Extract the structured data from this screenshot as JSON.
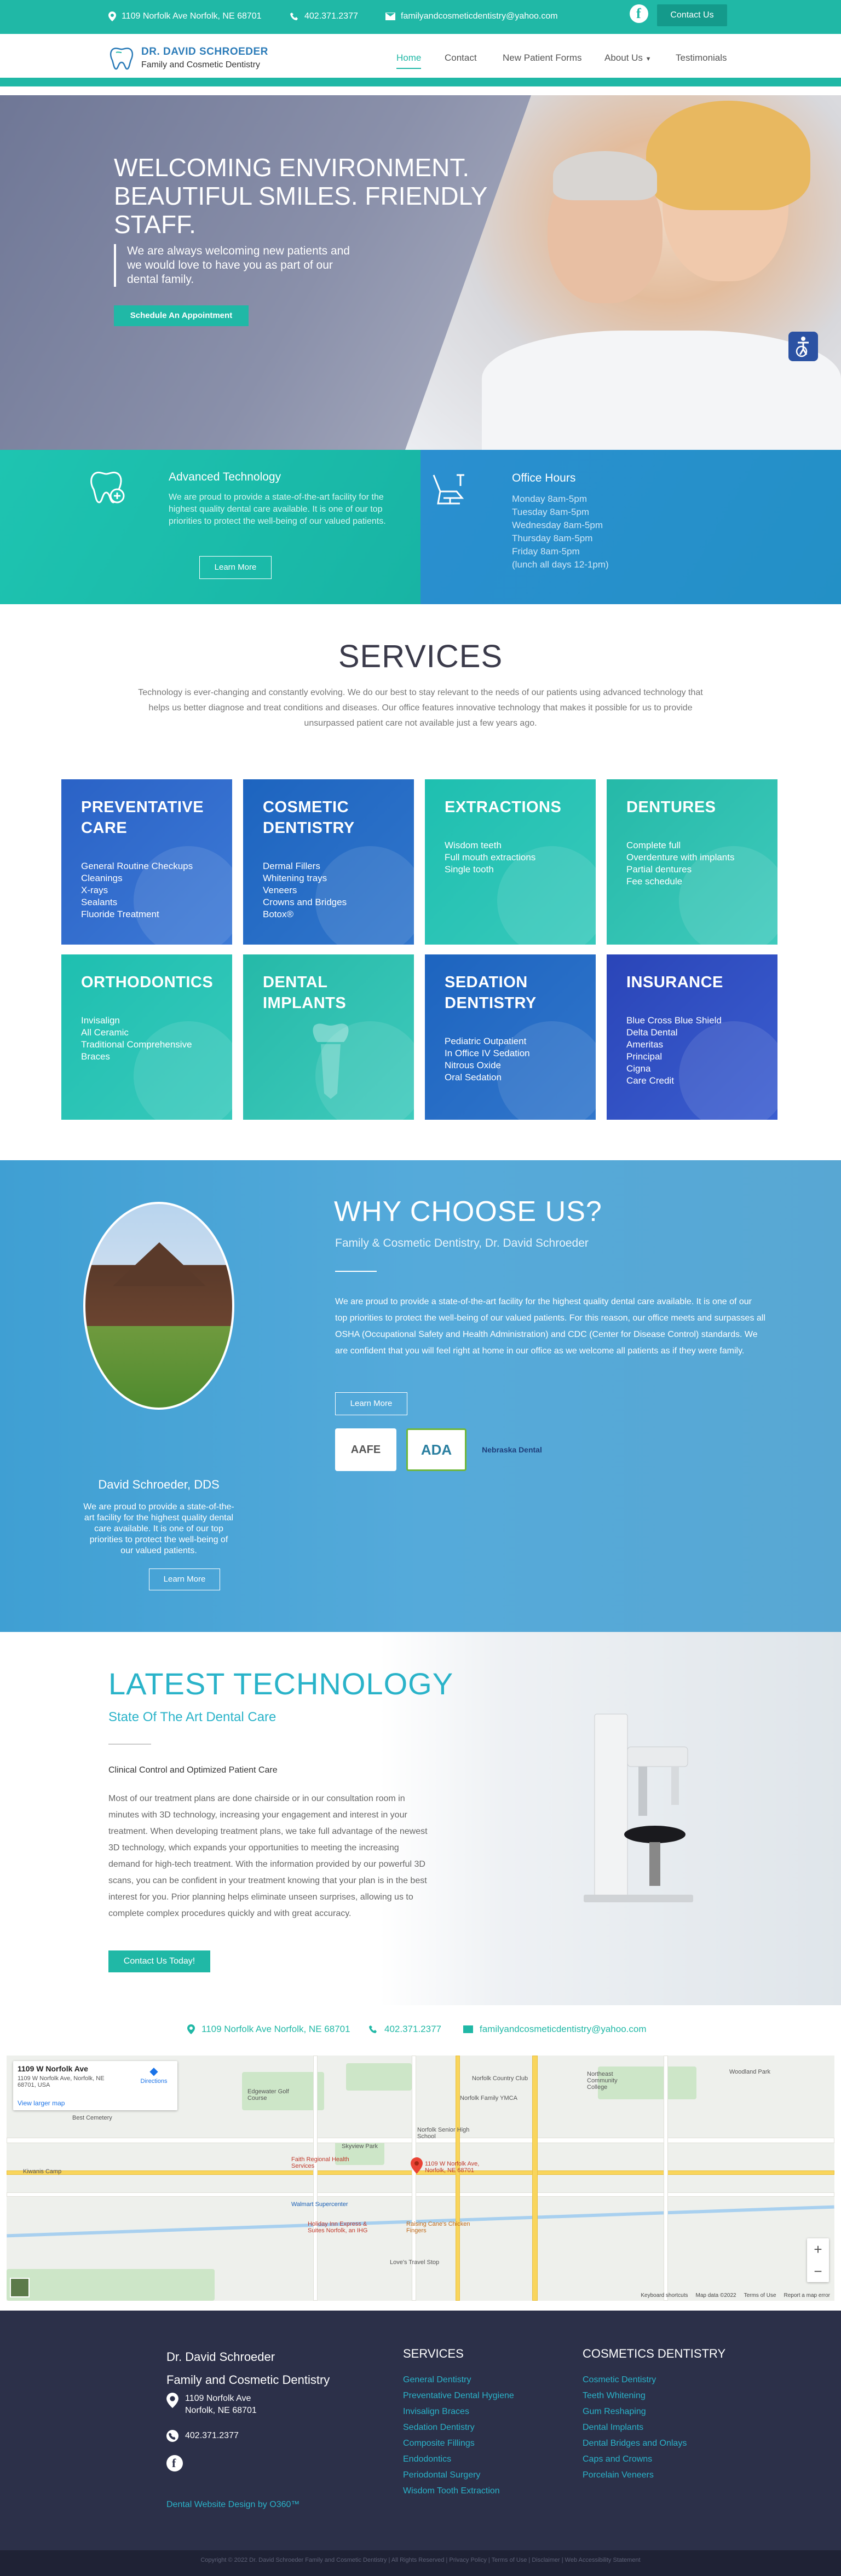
{
  "topbar": {
    "address": "1109 Norfolk Ave Norfolk, NE 68701",
    "phone": "402.371.2377",
    "email": "familyandcosmeticdentistry@yahoo.com",
    "contact_label": "Contact Us",
    "bg_color": "#20b8a6"
  },
  "logo": {
    "title": "DR. DAVID SCHROEDER",
    "subtitle": "Family and Cosmetic Dentistry"
  },
  "nav": {
    "items": [
      {
        "label": "Home"
      },
      {
        "label": "Contact"
      },
      {
        "label": "New Patient Forms"
      },
      {
        "label": "About Us"
      },
      {
        "label": "Testimonials"
      }
    ],
    "active": "Home"
  },
  "hero": {
    "headline": "WELCOMING ENVIRONMENT. BEAUTIFUL SMILES. FRIENDLY STAFF.",
    "tagline": "We are always welcoming new patients and we would love to have you as part of our dental family.",
    "button": "Schedule An Appointment"
  },
  "info": {
    "tech_title": "Advanced Technology",
    "tech_text": "We are proud to provide a state-of-the-art facility for the highest quality dental care available. It is one of our top priorities to protect the well-being of our valued patients.",
    "tech_button": "Learn More",
    "hours_title": "Office Hours",
    "hours": [
      "Monday 8am-5pm",
      "Tuesday 8am-5pm",
      "Wednesday 8am-5pm",
      "Thursday 8am-5pm",
      "Friday 8am-5pm",
      "(lunch all days 12-1pm)"
    ]
  },
  "services": {
    "title": "SERVICES",
    "text": "Technology is ever-changing and constantly evolving. We do our best to stay relevant to the needs of our patients using advanced technology that helps us better diagnose and treat conditions and diseases. Our office features innovative technology that makes it possible for us to provide unsurpassed patient care not available just a few years ago.",
    "cards": [
      {
        "title": "PREVENTATIVE CARE",
        "items": [
          "General Routine Checkups",
          "Cleanings",
          "X-rays",
          "Sealants",
          "Fluoride Treatment"
        ]
      },
      {
        "title": "COSMETIC DENTISTRY",
        "items": [
          "Dermal Fillers",
          "Whitening trays",
          "Veneers",
          "Crowns and Bridges",
          "Botox®"
        ]
      },
      {
        "title": "EXTRACTIONS",
        "items": [
          "Wisdom teeth",
          "Full mouth extractions",
          "Single tooth"
        ]
      },
      {
        "title": "DENTURES",
        "items": [
          "Complete full",
          "Overdenture with implants",
          "Partial dentures",
          "Fee schedule"
        ]
      },
      {
        "title": "ORTHODONTICS",
        "items": [
          "Invisalign",
          "All Ceramic",
          "Traditional Comprehensive",
          "Braces"
        ]
      },
      {
        "title": "DENTAL IMPLANTS",
        "items": []
      },
      {
        "title": "SEDATION DENTISTRY",
        "items": [
          "Pediatric Outpatient",
          "In Office IV Sedation",
          "Nitrous Oxide",
          "Oral Sedation"
        ]
      },
      {
        "title": "INSURANCE",
        "items": [
          "Blue Cross Blue Shield",
          "Delta Dental",
          "Ameritas",
          "Principal",
          "Cigna",
          "Care Credit"
        ]
      }
    ]
  },
  "why": {
    "title": "WHY CHOOSE US?",
    "subtitle": "Family & Cosmetic Dentistry, Dr. David Schroeder",
    "text": "We are proud to provide a state-of-the-art facility for the highest quality dental care available. It is one of our top priorities to protect the well-being of our valued patients. For this reason, our office meets and surpasses all OSHA (Occupational Safety and Health Administration) and CDC (Center for Disease Control) standards. We are confident that you will feel right at home in our office as we welcome all patients as if they were family.",
    "button": "Learn More",
    "badges": [
      "AAFE",
      "ADA",
      "Nebraska Dental"
    ],
    "doctor_name": "David Schroeder, DDS",
    "doctor_text": "We are proud to provide a state-of-the-art facility for the highest quality dental care available. It is one of our top priorities to protect the well-being of our valued patients.",
    "doctor_button": "Learn More"
  },
  "tech": {
    "title": "LATEST TECHNOLOGY",
    "subtitle": "State Of The Art Dental Care",
    "heading": "Clinical Control and Optimized Patient Care",
    "text": "Most of our treatment plans are done chairside or in our consultation room in minutes with 3D technology, increasing your engagement and interest in your treatment. When developing treatment plans, we take full advantage of the newest 3D technology, which expands your opportunities to meeting the increasing demand for high-tech treatment. With the information provided by our powerful 3D scans, you can be confident in your treatment knowing that your plan is in the best interest for you. Prior planning helps eliminate unseen surprises, allowing us to complete complex procedures quickly and with great accuracy.",
    "button": "Contact Us Today!"
  },
  "contact_row": {
    "address": "1109 Norfolk Ave Norfolk, NE 68701",
    "phone": "402.371.2377",
    "email": "familyandcosmeticdentistry@yahoo.com"
  },
  "map": {
    "card_title": "1109 W Norfolk Ave",
    "card_address": "1109 W Norfolk Ave, Norfolk, NE 68701, USA",
    "directions": "Directions",
    "view_larger": "View larger map",
    "pin_label": "1109 W Norfolk Ave, Norfolk, NE 68701",
    "places": [
      "Norfolk Country Club",
      "Northeast Community College",
      "Woodland Park",
      "Edgewater Golf Course",
      "Norfolk Family YMCA",
      "Norfolk Senior High School",
      "Skyview Park",
      "Faith Regional Health Services",
      "Walmart Supercenter",
      "Holiday Inn Express & Suites Norfolk, an IHG",
      "Raising Cane's Chicken Fingers",
      "Best Cemetery",
      "Kiwanis Camp",
      "Love's Travel Stop"
    ],
    "footer_labels": [
      "Keyboard shortcuts",
      "Map data ©2022",
      "Terms of Use",
      "Report a map error"
    ]
  },
  "footer": {
    "name_line1": "Dr. David Schroeder",
    "name_line2": "Family and Cosmetic Dentistry",
    "address_line1": "1109 Norfolk Ave",
    "address_line2": "Norfolk, NE 68701",
    "phone": "402.371.2377",
    "credit": "Dental Website Design by O360™",
    "services_title": "SERVICES",
    "services": [
      "General Dentistry",
      "Preventative Dental Hygiene",
      "Invisalign Braces",
      "Sedation Dentistry",
      "Composite Fillings",
      "Endodontics",
      "Periodontal Surgery",
      "Wisdom Tooth Extraction"
    ],
    "cosmetic_title": "COSMETICS DENTISTRY",
    "cosmetic": [
      "Cosmetic Dentistry",
      "Teeth Whitening",
      "Gum Reshaping",
      "Dental Implants",
      "Dental Bridges and Onlays",
      "Caps and Crowns",
      "Porcelain Veneers"
    ],
    "copyright": "Copyright © 2022 Dr. David Schroeder Family and Cosmetic Dentistry | All Rights Reserved | Privacy Policy | Terms of Use | Disclaimer | Web Accessibility Statement"
  }
}
